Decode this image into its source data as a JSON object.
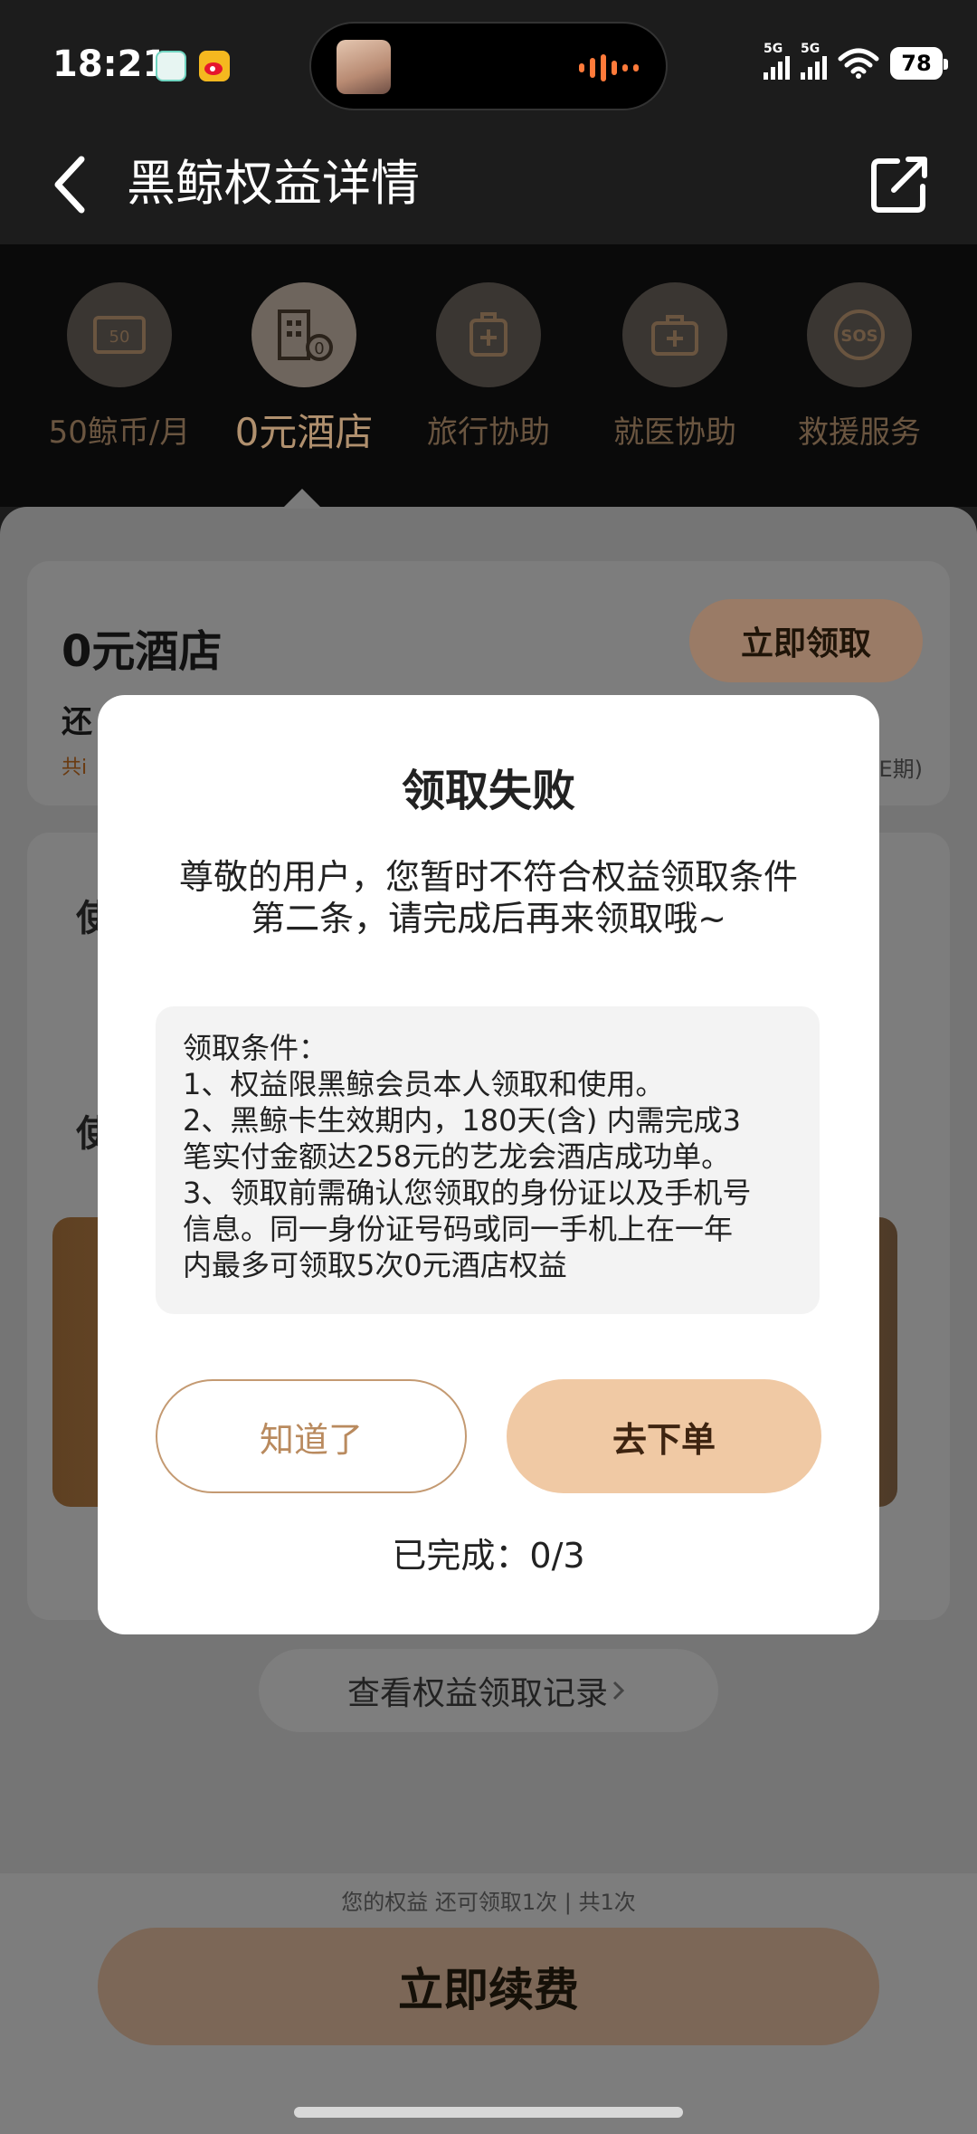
{
  "status_bar": {
    "time": "18:21",
    "network_1": "5G",
    "network_2": "5G",
    "battery": "78",
    "icons": [
      "message-app-icon",
      "weibo-icon",
      "signal-icon",
      "wifi-icon",
      "battery-icon"
    ]
  },
  "nav": {
    "title": "黑鲸权益详情",
    "back_icon": "chevron-left-icon",
    "share_icon": "share-icon"
  },
  "benefits": [
    {
      "label": "50鲸币/月",
      "icon": "coupon-icon"
    },
    {
      "label": "0元酒店",
      "icon": "hotel-icon"
    },
    {
      "label": "旅行协助",
      "icon": "luggage-icon"
    },
    {
      "label": "就医协助",
      "icon": "medical-kit-icon"
    },
    {
      "label": "救援服务",
      "icon": "sos-icon"
    }
  ],
  "active_benefit": "0元酒店",
  "card": {
    "title": "0元酒店",
    "subtitle_partial": "还",
    "note_partial": "共i",
    "note_right_partial": "E期)",
    "claim_button": "立即领取"
  },
  "card2": {
    "heading_1_partial": "使",
    "heading_2_partial": "使"
  },
  "modal": {
    "title": "领取失败",
    "message_line1": "尊敬的用户，您暂时不符合权益领取条件",
    "message_line2": "第二条，请完成后再来领取哦~",
    "conditions": [
      "领取条件：",
      "1、权益限黑鲸会员本人领取和使用。",
      "2、黑鲸卡生效期内，180天(含) 内需完成3",
      "笔实付金额达258元的艺龙会酒店成功单。",
      "3、领取前需确认您领取的身份证以及手机号",
      "信息。同一身份证号码或同一手机上在一年",
      "内最多可领取5次0元酒店权益"
    ],
    "ok_button": "知道了",
    "order_button": "去下单",
    "progress": "已完成：0/3"
  },
  "record_link": "查看权益领取记录",
  "bottom": {
    "status": "您的权益 还可领取1次 | 共1次",
    "renew_button": "立即续费"
  },
  "colors": {
    "accent": "#f0c9a4",
    "accent_text": "#b98a5e",
    "nav_bg": "#1c1c1c"
  }
}
